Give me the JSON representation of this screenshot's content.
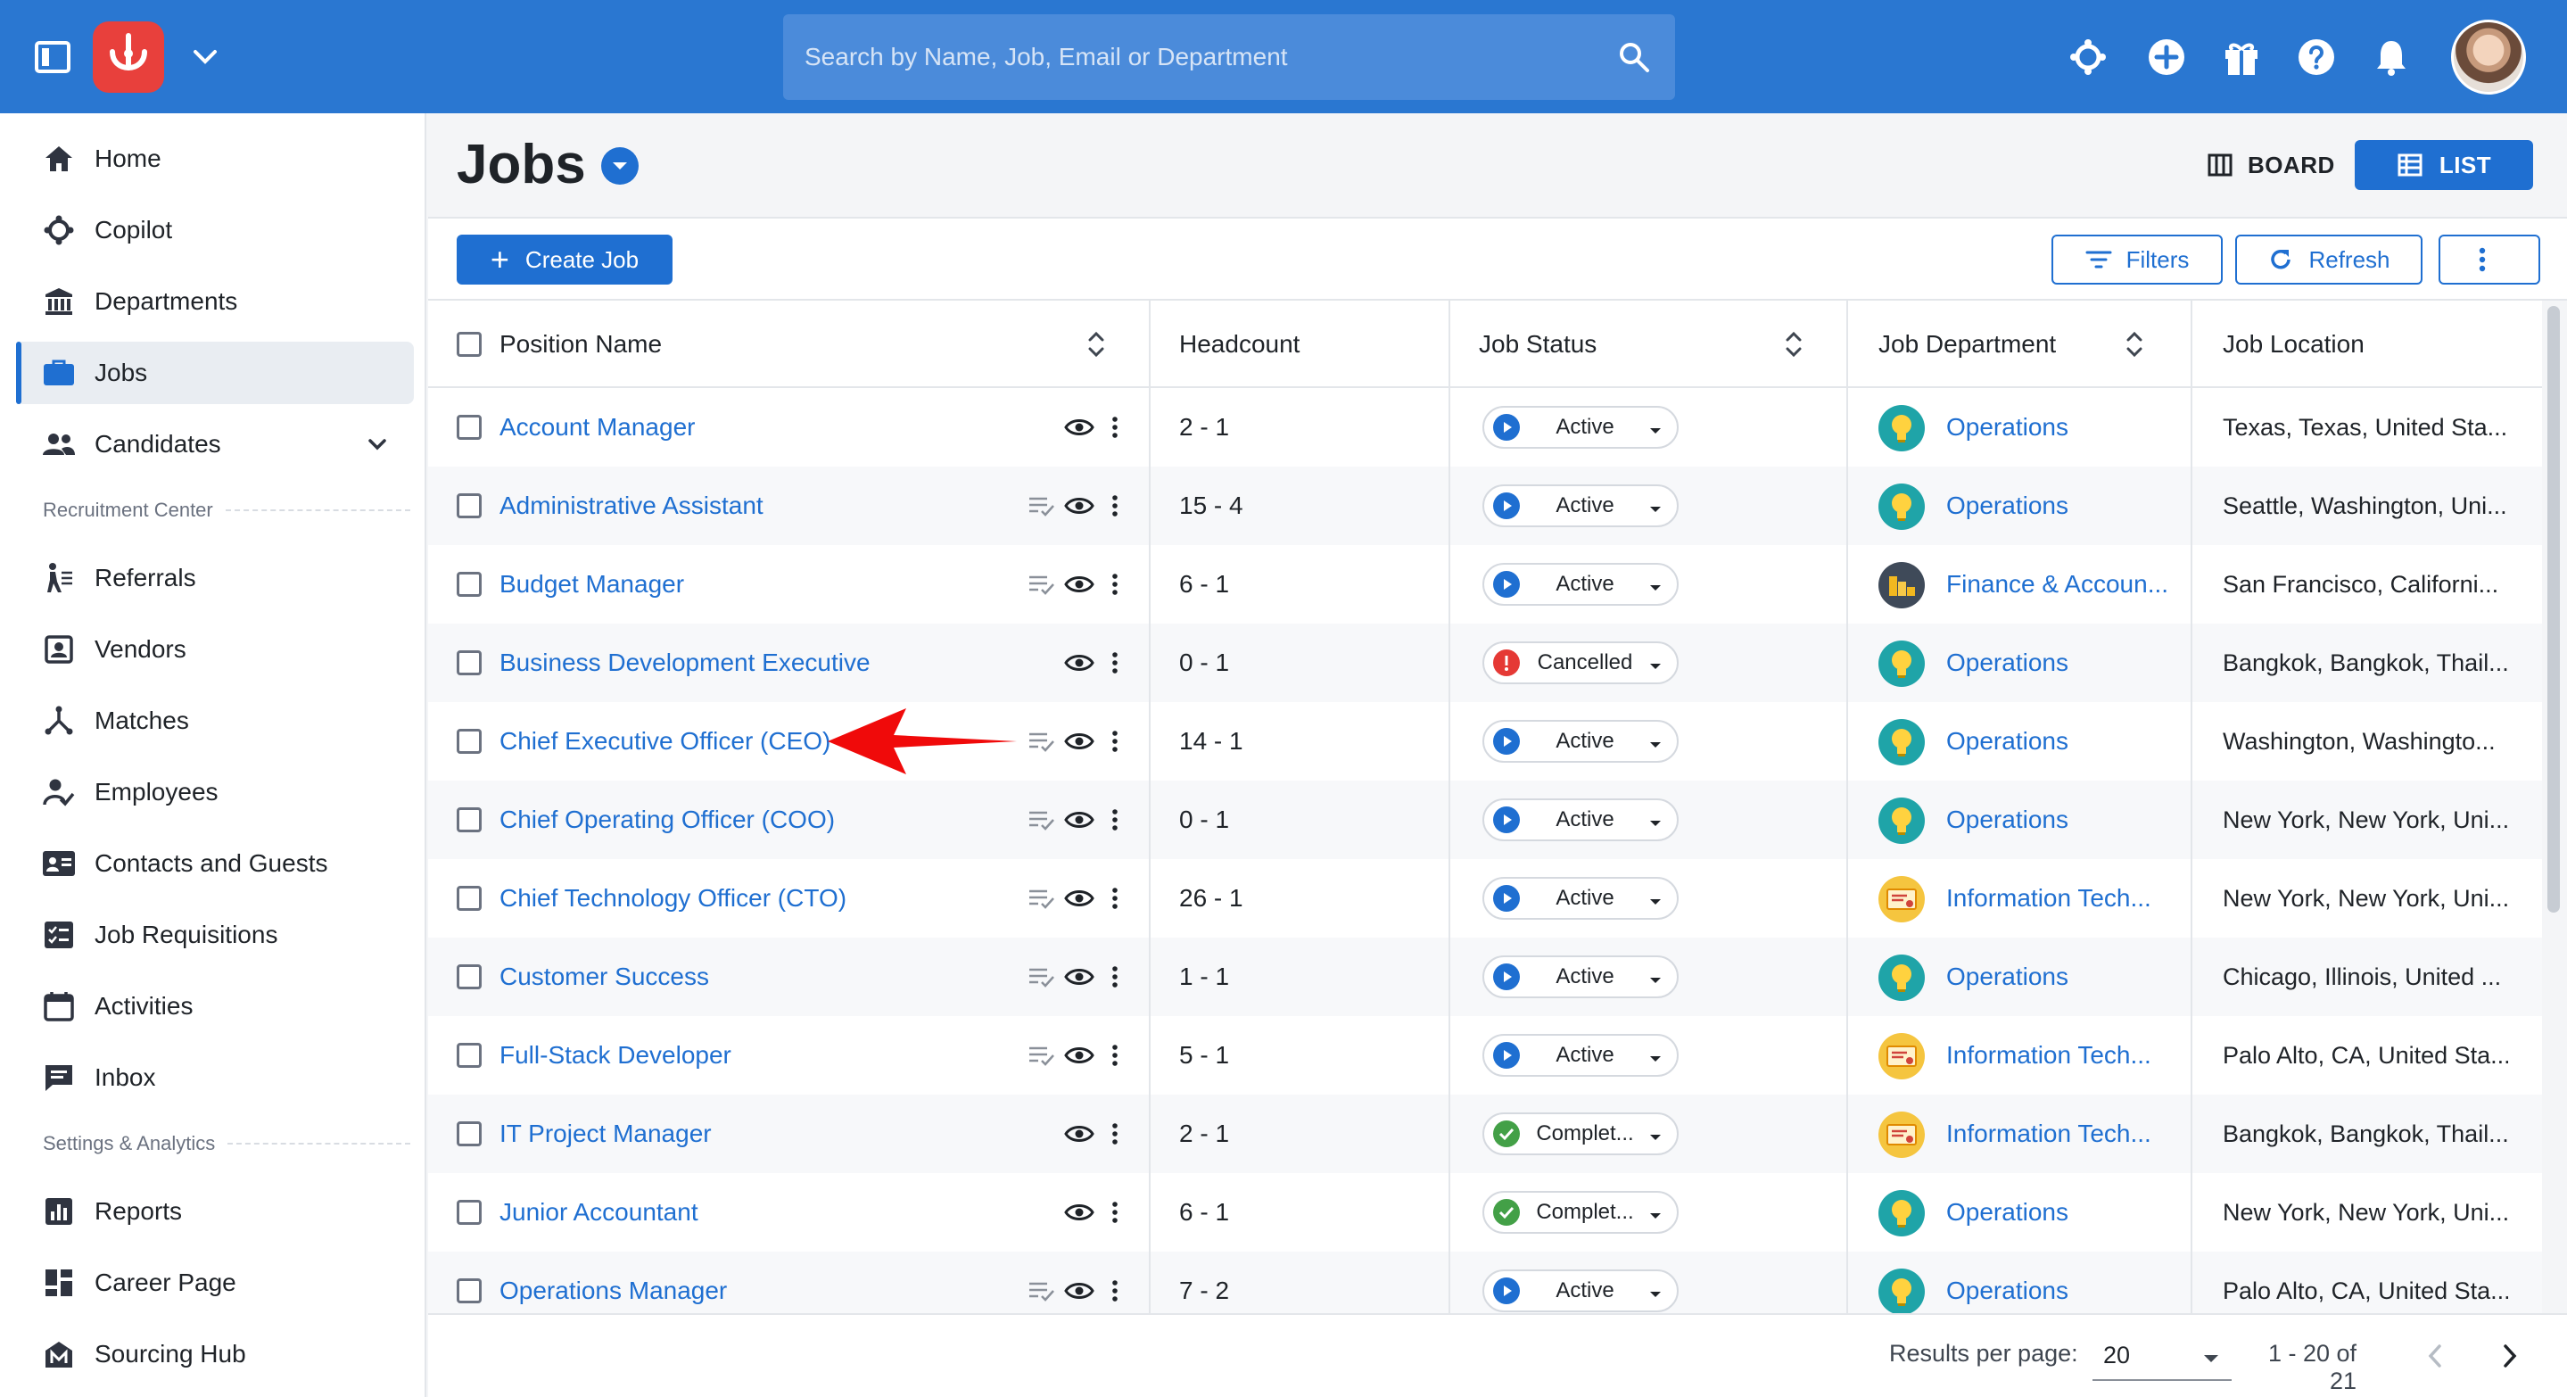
{
  "search": {
    "placeholder": "Search by Name, Job, Email or Department"
  },
  "sidebar": {
    "items": [
      {
        "label": "Home",
        "icon": "home-icon"
      },
      {
        "label": "Copilot",
        "icon": "copilot-icon"
      },
      {
        "label": "Departments",
        "icon": "departments-icon"
      },
      {
        "label": "Jobs",
        "icon": "briefcase-icon",
        "active": true
      },
      {
        "label": "Candidates",
        "icon": "people-icon"
      },
      {
        "label": "Referrals",
        "icon": "referral-icon"
      },
      {
        "label": "Vendors",
        "icon": "vendor-icon"
      },
      {
        "label": "Matches",
        "icon": "matches-icon"
      },
      {
        "label": "Employees",
        "icon": "employee-icon"
      },
      {
        "label": "Contacts and Guests",
        "icon": "contacts-icon"
      },
      {
        "label": "Job Requisitions",
        "icon": "requisition-icon"
      },
      {
        "label": "Activities",
        "icon": "calendar-icon"
      },
      {
        "label": "Inbox",
        "icon": "inbox-icon"
      },
      {
        "label": "Reports",
        "icon": "reports-icon"
      },
      {
        "label": "Career Page",
        "icon": "career-page-icon"
      },
      {
        "label": "Sourcing Hub",
        "icon": "sourcing-hub-icon"
      }
    ],
    "sections": {
      "recruitment": "Recruitment Center",
      "settings": "Settings & Analytics"
    }
  },
  "header": {
    "title": "Jobs",
    "board_label": "BOARD",
    "list_label": "LIST"
  },
  "toolbar": {
    "create_label": "Create Job",
    "filters_label": "Filters",
    "refresh_label": "Refresh"
  },
  "table": {
    "columns": {
      "position": "Position Name",
      "headcount": "Headcount",
      "status": "Job Status",
      "department": "Job Department",
      "location": "Job Location"
    },
    "rows": [
      {
        "position": "Account Manager",
        "headcount": "2 - 1",
        "status": "Active",
        "department": "Operations",
        "dept_icon": "lightbulb",
        "location": "Texas, Texas, United Sta...",
        "has_notes": false
      },
      {
        "position": "Administrative Assistant",
        "headcount": "15 - 4",
        "status": "Active",
        "department": "Operations",
        "dept_icon": "lightbulb",
        "location": "Seattle, Washington, Uni...",
        "has_notes": true
      },
      {
        "position": "Budget Manager",
        "headcount": "6 - 1",
        "status": "Active",
        "department": "Finance & Accoun...",
        "dept_icon": "coins",
        "location": "San Francisco, Californi...",
        "has_notes": true
      },
      {
        "position": "Business Development Executive",
        "headcount": "0 - 1",
        "status": "Cancelled",
        "department": "Operations",
        "dept_icon": "lightbulb",
        "location": "Bangkok, Bangkok, Thail...",
        "has_notes": false
      },
      {
        "position": "Chief Executive Officer (CEO)",
        "headcount": "14 - 1",
        "status": "Active",
        "department": "Operations",
        "dept_icon": "lightbulb",
        "location": "Washington, Washingto...",
        "has_notes": true
      },
      {
        "position": "Chief Operating Officer (COO)",
        "headcount": "0 - 1",
        "status": "Active",
        "department": "Operations",
        "dept_icon": "lightbulb",
        "location": "New York, New York, Uni...",
        "has_notes": true
      },
      {
        "position": "Chief Technology Officer (CTO)",
        "headcount": "26 - 1",
        "status": "Active",
        "department": "Information Tech...",
        "dept_icon": "certificate",
        "location": "New York, New York, Uni...",
        "has_notes": true
      },
      {
        "position": "Customer Success",
        "headcount": "1 - 1",
        "status": "Active",
        "department": "Operations",
        "dept_icon": "lightbulb",
        "location": "Chicago, Illinois, United ...",
        "has_notes": true
      },
      {
        "position": "Full-Stack Developer",
        "headcount": "5 - 1",
        "status": "Active",
        "department": "Information Tech...",
        "dept_icon": "certificate",
        "location": "Palo Alto, CA, United Sta...",
        "has_notes": true
      },
      {
        "position": "IT Project Manager",
        "headcount": "2 - 1",
        "status": "Complet...",
        "department": "Information Tech...",
        "dept_icon": "certificate",
        "location": "Bangkok, Bangkok, Thail...",
        "has_notes": false
      },
      {
        "position": "Junior Accountant",
        "headcount": "6 - 1",
        "status": "Complet...",
        "department": "Operations",
        "dept_icon": "lightbulb",
        "location": "New York, New York, Uni...",
        "has_notes": false
      },
      {
        "position": "Operations Manager",
        "headcount": "7 - 2",
        "status": "Active",
        "department": "Operations",
        "dept_icon": "lightbulb",
        "location": "Palo Alto, CA, United Sta...",
        "has_notes": true
      }
    ]
  },
  "footer": {
    "rpp_label": "Results per page:",
    "rpp_value": "20",
    "range": "1 - 20 of 21"
  },
  "colors": {
    "topbar": "#2a77d1",
    "primary": "#1f6fd1",
    "logo": "#e8403c",
    "status_active": "#1f6fd1",
    "status_cancelled": "#e53935",
    "status_completed": "#43a047",
    "annotation_arrow": "#f00a0a"
  }
}
